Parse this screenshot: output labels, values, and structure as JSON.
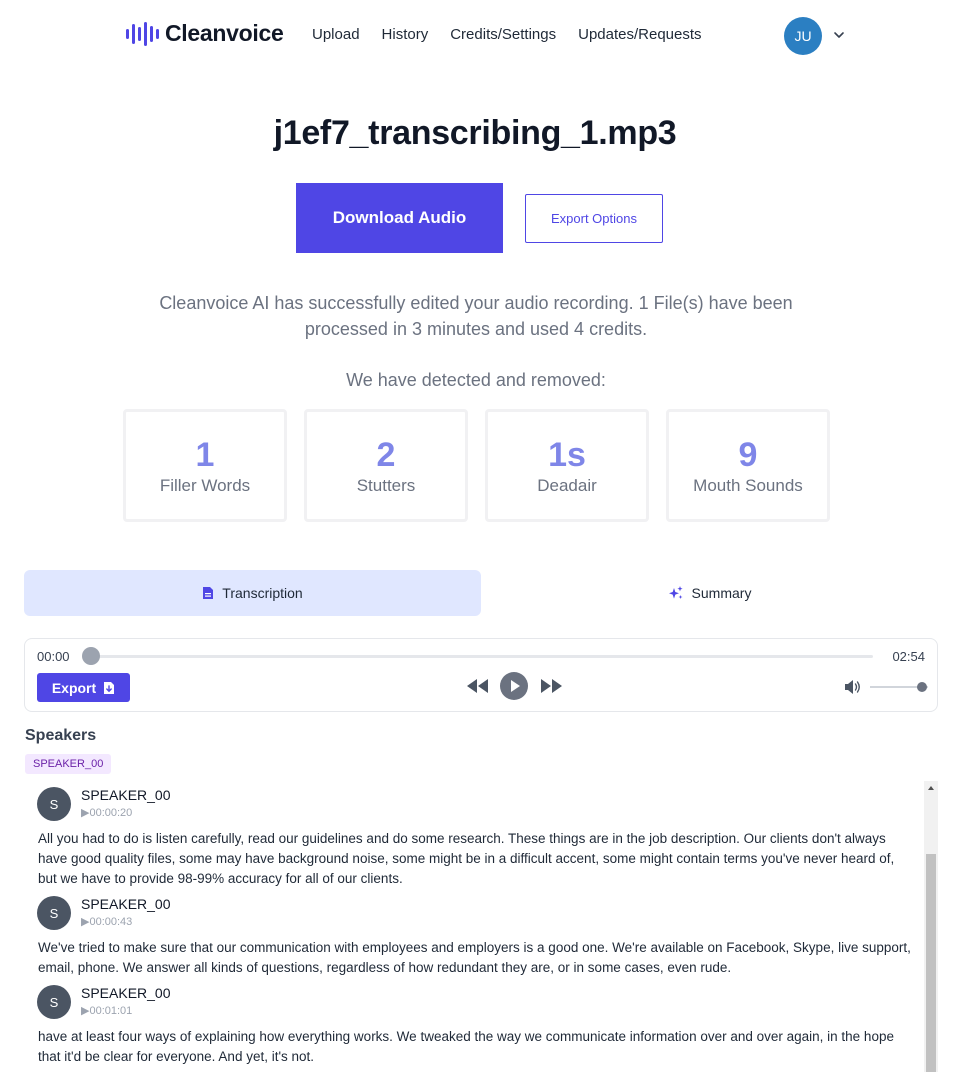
{
  "nav": {
    "brand": "Cleanvoice",
    "links": [
      "Upload",
      "History",
      "Credits/Settings",
      "Updates/Requests"
    ],
    "avatar_initials": "JU"
  },
  "header": {
    "file_name": "j1ef7_transcribing_1.mp3",
    "download_label": "Download Audio",
    "export_options_label": "Export Options",
    "description": "Cleanvoice AI has successfully edited your audio recording. 1 File(s) have been processed in 3 minutes and used 4 credits.",
    "detected_heading": "We have detected and removed:"
  },
  "stats": [
    {
      "value": "1",
      "label": "Filler Words"
    },
    {
      "value": "2",
      "label": "Stutters"
    },
    {
      "value": "1s",
      "label": "Deadair"
    },
    {
      "value": "9",
      "label": "Mouth Sounds"
    }
  ],
  "tabs": {
    "transcription": "Transcription",
    "summary": "Summary"
  },
  "player": {
    "current_time": "00:00",
    "duration": "02:54",
    "progress": 0,
    "volume": 0.9,
    "export_label": "Export"
  },
  "speakers": {
    "title": "Speakers",
    "tag": "SPEAKER_00"
  },
  "segments": [
    {
      "initial": "S",
      "speaker": "SPEAKER_00",
      "time": "▶00:00:20",
      "text": "All you had to do is listen carefully, read our guidelines and do some research. These things are in the job description. Our clients don't always have good quality files, some may have background noise, some might be in a difficult accent, some might contain terms you've never heard of, but we have to provide 98-99% accuracy for all of our clients."
    },
    {
      "initial": "S",
      "speaker": "SPEAKER_00",
      "time": "▶00:00:43",
      "text": "We've tried to make sure that our communication with employees and employers is a good one. We're available on Facebook, Skype, live support, email, phone. We answer all kinds of questions, regardless of how redundant they are, or in some cases, even rude."
    },
    {
      "initial": "S",
      "speaker": "SPEAKER_00",
      "time": "▶00:01:01",
      "text": "have at least four ways of explaining how everything works. We tweaked the way we communicate information over and over again, in the hope that it'd be clear for everyone. And yet, it's not."
    }
  ],
  "colors": {
    "accent": "#4f46e5",
    "stat_value": "#7f86e8",
    "avatar": "#2b7fc2",
    "tab_active_bg": "#e0e7ff",
    "speaker_tag_bg": "#f3e8ff"
  }
}
